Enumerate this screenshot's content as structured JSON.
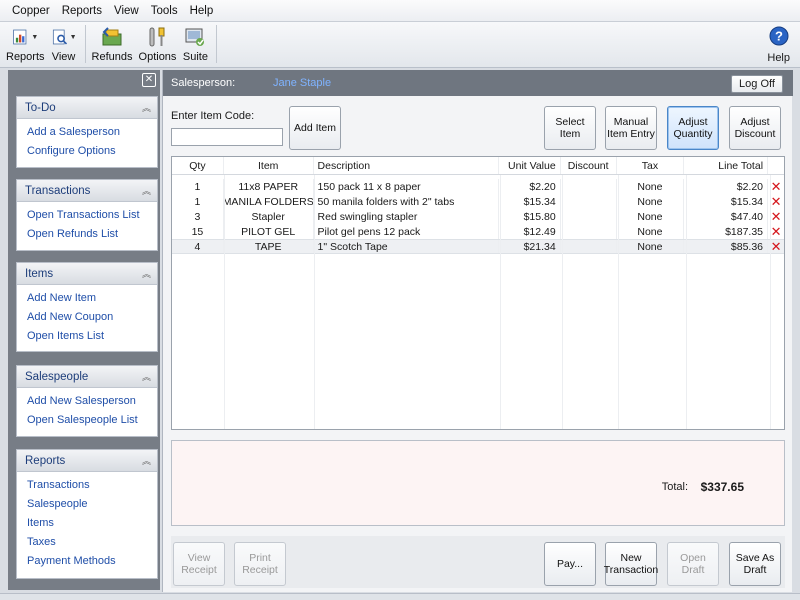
{
  "menu": [
    "Copper",
    "Reports",
    "View",
    "Tools",
    "Help"
  ],
  "toolbar": {
    "reports": "Reports",
    "view": "View",
    "refunds": "Refunds",
    "options": "Options",
    "suite": "Suite",
    "help": "Help"
  },
  "nav": {
    "sections": [
      {
        "title": "To-Do",
        "links": [
          "Add a Salesperson",
          "Configure Options"
        ]
      },
      {
        "title": "Transactions",
        "links": [
          "Open Transactions List",
          "Open Refunds List"
        ]
      },
      {
        "title": "Items",
        "links": [
          "Add New Item",
          "Add New Coupon",
          "Open Items List"
        ]
      },
      {
        "title": "Salespeople",
        "links": [
          "Add New Salesperson",
          "Open Salespeople List"
        ]
      },
      {
        "title": "Reports",
        "links": [
          "Transactions",
          "Salespeople",
          "Items",
          "Taxes",
          "Payment Methods"
        ]
      }
    ]
  },
  "salesperson": {
    "label": "Salesperson:",
    "name": "Jane Staple",
    "logoff": "Log Off"
  },
  "entry": {
    "item_code_label": "Enter Item Code:",
    "item_code_value": "",
    "add_item": "Add Item",
    "select_item": "Select Item",
    "manual_entry": "Manual Item Entry",
    "adjust_quantity": "Adjust Quantity",
    "adjust_discount": "Adjust Discount"
  },
  "table": {
    "headers": {
      "qty": "Qty",
      "item": "Item",
      "description": "Description",
      "unit_value": "Unit Value",
      "discount": "Discount",
      "tax": "Tax",
      "line_total": "Line Total"
    },
    "rows": [
      {
        "qty": "1",
        "item": "11x8 PAPER",
        "description": "150 pack 11 x 8 paper",
        "unit_value": "$2.20",
        "discount": "",
        "tax": "None",
        "line_total": "$2.20"
      },
      {
        "qty": "1",
        "item": "MANILA FOLDERS",
        "description": "50 manila folders with 2\" tabs",
        "unit_value": "$15.34",
        "discount": "",
        "tax": "None",
        "line_total": "$15.34"
      },
      {
        "qty": "3",
        "item": "Stapler",
        "description": "Red swingling stapler",
        "unit_value": "$15.80",
        "discount": "",
        "tax": "None",
        "line_total": "$47.40"
      },
      {
        "qty": "15",
        "item": "PILOT GEL",
        "description": "Pilot gel pens 12 pack",
        "unit_value": "$12.49",
        "discount": "",
        "tax": "None",
        "line_total": "$187.35"
      },
      {
        "qty": "4",
        "item": "TAPE",
        "description": "1\" Scotch Tape",
        "unit_value": "$21.34",
        "discount": "",
        "tax": "None",
        "line_total": "$85.36"
      }
    ]
  },
  "totals": {
    "label": "Total:",
    "value": "$337.65"
  },
  "actions": {
    "view_receipt": "View Receipt",
    "print_receipt": "Print Receipt",
    "pay": "Pay...",
    "new_transaction": "New Transaction",
    "open_draft": "Open Draft",
    "save_draft": "Save As Draft"
  },
  "colors": {
    "accent": "#1f4ea8",
    "delete": "#d4151b",
    "header_bar": "#6f7680"
  }
}
